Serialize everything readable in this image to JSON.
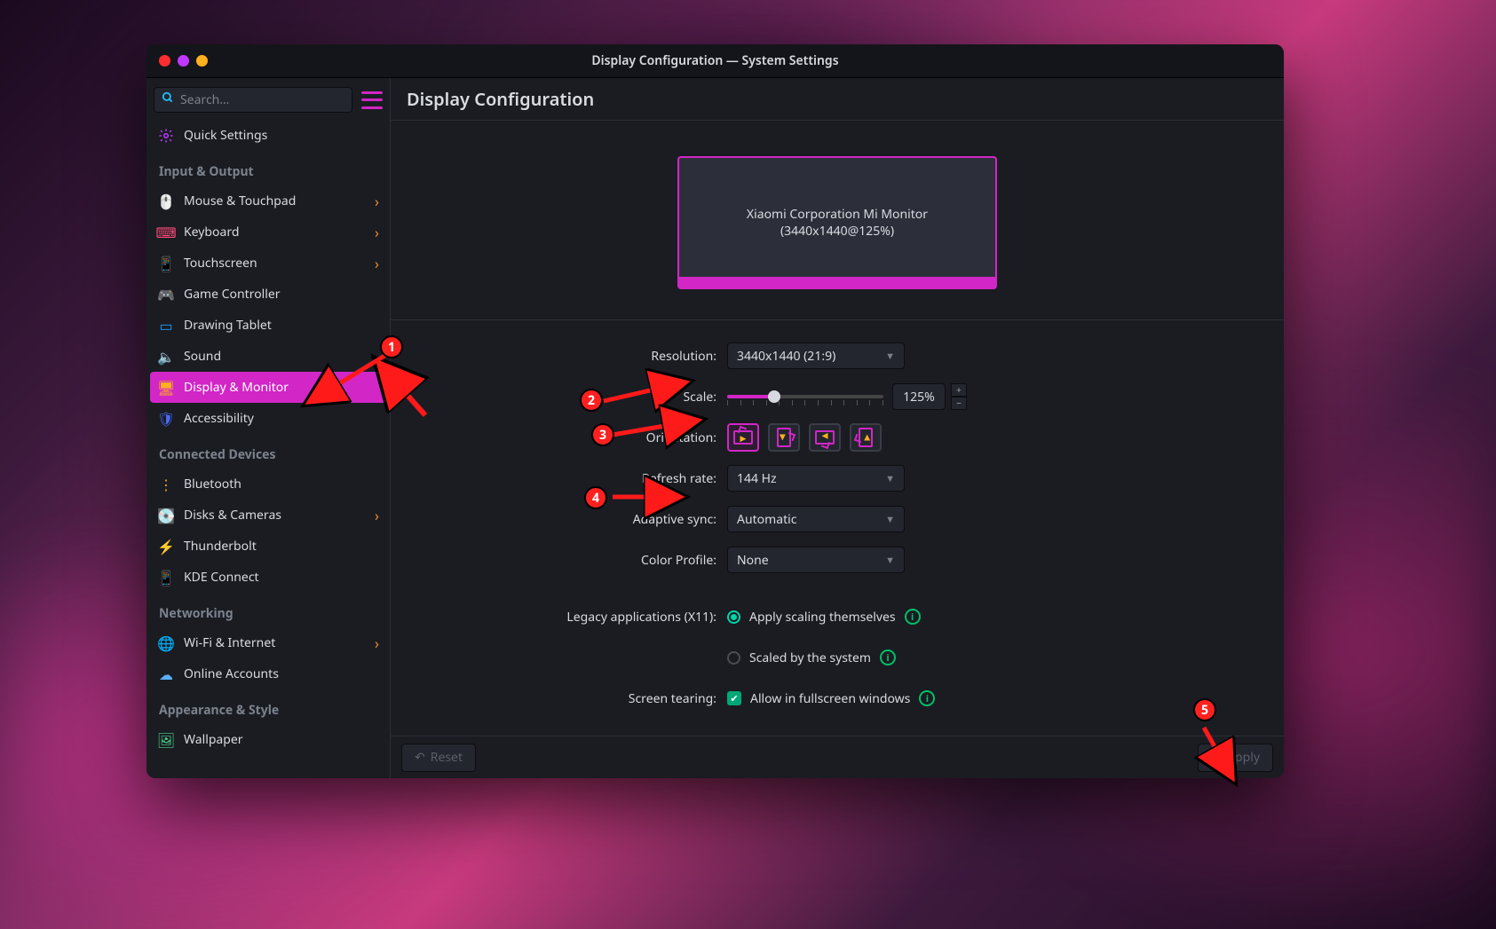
{
  "window_title": "Display Configuration — System Settings",
  "page_title": "Display Configuration",
  "search_placeholder": "Search…",
  "sidebar": {
    "quick": "Quick Settings",
    "sec1": "Input & Output",
    "items1": [
      {
        "label": "Mouse & Touchpad",
        "chev": true
      },
      {
        "label": "Keyboard",
        "chev": true
      },
      {
        "label": "Touchscreen",
        "chev": true
      },
      {
        "label": "Game Controller",
        "chev": false
      },
      {
        "label": "Drawing Tablet",
        "chev": false
      },
      {
        "label": "Sound",
        "chev": false
      },
      {
        "label": "Display & Monitor",
        "chev": false,
        "active": true
      },
      {
        "label": "Accessibility",
        "chev": false
      }
    ],
    "sec2": "Connected Devices",
    "items2": [
      {
        "label": "Bluetooth",
        "chev": false
      },
      {
        "label": "Disks & Cameras",
        "chev": true
      },
      {
        "label": "Thunderbolt",
        "chev": false
      },
      {
        "label": "KDE Connect",
        "chev": false
      }
    ],
    "sec3": "Networking",
    "items3": [
      {
        "label": "Wi-Fi & Internet",
        "chev": true
      },
      {
        "label": "Online Accounts",
        "chev": false
      }
    ],
    "sec4": "Appearance & Style",
    "items4": [
      {
        "label": "Wallpaper",
        "chev": false
      }
    ]
  },
  "monitor": {
    "name": "Xiaomi Corporation Mi Monitor",
    "mode": "(3440x1440@125%)"
  },
  "form": {
    "resolution_label": "Resolution:",
    "resolution_value": "3440x1440 (21:9)",
    "scale_label": "Scale:",
    "scale_value": "125%",
    "orientation_label": "Orientation:",
    "refresh_label": "Refresh rate:",
    "refresh_value": "144 Hz",
    "adaptive_label": "Adaptive sync:",
    "adaptive_value": "Automatic",
    "color_label": "Color Profile:",
    "color_value": "None",
    "legacy_label": "Legacy applications (X11):",
    "legacy_opt1": "Apply scaling themselves",
    "legacy_opt2": "Scaled by the system",
    "tearing_label": "Screen tearing:",
    "tearing_opt": "Allow in fullscreen windows"
  },
  "buttons": {
    "reset": "Reset",
    "apply": "Apply"
  },
  "annotations": {
    "1": "1",
    "2": "2",
    "3": "3",
    "4": "4",
    "5": "5"
  }
}
